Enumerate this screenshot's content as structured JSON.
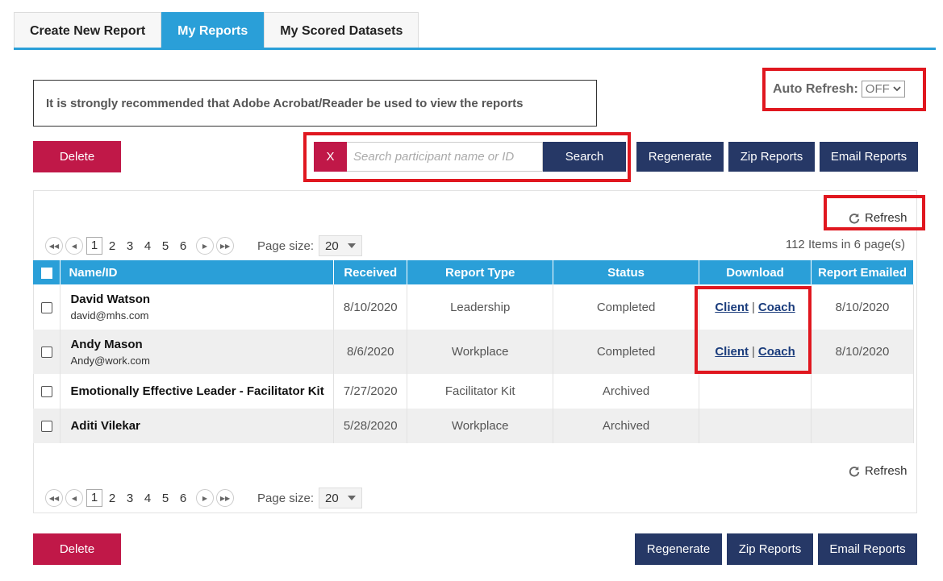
{
  "tabs": [
    "Create New Report",
    "My Reports",
    "My Scored Datasets"
  ],
  "notice": "It is strongly recommended that Adobe Acrobat/Reader be used to view the reports",
  "auto_refresh": {
    "label": "Auto Refresh:",
    "value": "OFF"
  },
  "buttons": {
    "delete": "Delete",
    "regenerate": "Regenerate",
    "zip": "Zip Reports",
    "email": "Email Reports"
  },
  "search": {
    "clear": "X",
    "placeholder": "Search participant name or ID",
    "button": "Search"
  },
  "refresh_label": "Refresh",
  "pager": {
    "pages": [
      "1",
      "2",
      "3",
      "4",
      "5",
      "6"
    ],
    "page_size_label": "Page size:",
    "page_size": "20",
    "items_info": "112 Items in 6 page(s)"
  },
  "columns": [
    "Name/ID",
    "Received",
    "Report Type",
    "Status",
    "Download",
    "Report Emailed"
  ],
  "rows": [
    {
      "name": "David Watson",
      "email": "david@mhs.com",
      "received": "8/10/2020",
      "type": "Leadership",
      "status": "Completed",
      "client": "Client",
      "coach": "Coach",
      "emailed": "8/10/2020"
    },
    {
      "name": "Andy Mason",
      "email": "Andy@work.com",
      "received": "8/6/2020",
      "type": "Workplace",
      "status": "Completed",
      "client": "Client",
      "coach": "Coach",
      "emailed": "8/10/2020"
    },
    {
      "name": "Emotionally Effective Leader - Facilitator Kit",
      "received": "7/27/2020",
      "type": "Facilitator Kit",
      "status": "Archived"
    },
    {
      "name": "Aditi Vilekar",
      "received": "5/28/2020",
      "type": "Workplace",
      "status": "Archived"
    }
  ],
  "separator": "|",
  "colors": {
    "accent": "#2a9fd8",
    "navy": "#263866",
    "red": "#c01848",
    "highlight": "#e0171f"
  }
}
